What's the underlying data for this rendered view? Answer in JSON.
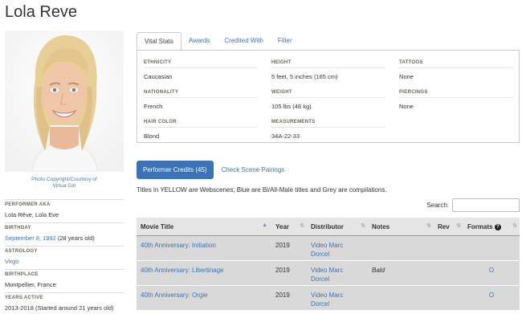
{
  "page": {
    "title": "Lola Reve"
  },
  "photo": {
    "credit": "Photo Copyright/Courtesy of\nVirtua Girl"
  },
  "info": [
    {
      "label": "PERFORMER AKA",
      "value": "Lola Rêve, Lola Eve"
    },
    {
      "label": "BIRTHDAY",
      "link": "September 8, 1992",
      "value": " (28 years old)"
    },
    {
      "label": "ASTROLOGY",
      "link": "Virgo",
      "value": ""
    },
    {
      "label": "BIRTHPLACE",
      "value": "Montpellier, France"
    },
    {
      "label": "YEARS ACTIVE",
      "value": "2013-2018 (Started around 21 years old)"
    }
  ],
  "tabs": [
    "Vital Stats",
    "Awards",
    "Credited With",
    "Filter"
  ],
  "stats": {
    "col1": [
      {
        "label": "ETHNICITY",
        "value": "Caucasian"
      },
      {
        "label": "NATIONALITY",
        "value": "French"
      },
      {
        "label": "HAIR COLOR",
        "value": "Blond"
      }
    ],
    "col2": [
      {
        "label": "HEIGHT",
        "value": "5 feet, 5 inches (165 cm)"
      },
      {
        "label": "WEIGHT",
        "value": "105 lbs (48 kg)"
      },
      {
        "label": "MEASUREMENTS",
        "value": "34A-22-33"
      }
    ],
    "col3": [
      {
        "label": "TATTOOS",
        "value": "None"
      },
      {
        "label": "PIERCINGS",
        "value": "None"
      }
    ]
  },
  "credits": {
    "button": "Performer Credits (45)",
    "alt_tab": "Check Scene Pairings",
    "note": "Titles in YELLOW are Webscenes; Blue are Bi/All-Male titles and Grey are compilations.",
    "search_label": "Search:",
    "search_value": ""
  },
  "table": {
    "columns": [
      "Movie Title",
      "Year",
      "Distributor",
      "Notes",
      "Rev",
      "Formats"
    ],
    "sort_arrow": "▲",
    "sort_both": "⇅",
    "help_icon": "?",
    "rows": [
      {
        "title": "40th Anniversary: Initiation",
        "year": "2019",
        "dist1": "Video Marc",
        "dist2": "Dorcel",
        "notes": "",
        "rev": "",
        "formats": ""
      },
      {
        "title": "40th Anniversary: Libertinage",
        "year": "2019",
        "dist1": "Video Marc",
        "dist2": "Dorcel",
        "notes": "Bald",
        "rev": "",
        "formats": "O"
      },
      {
        "title": "40th Anniversary: Orgie",
        "year": "2019",
        "dist1": "Video Marc",
        "dist2": "Dorcel",
        "notes": "",
        "rev": "",
        "formats": "O"
      }
    ]
  },
  "colors": {
    "link": "#3a73b7",
    "button": "#3a73b7",
    "row": "#d9d9d9"
  }
}
